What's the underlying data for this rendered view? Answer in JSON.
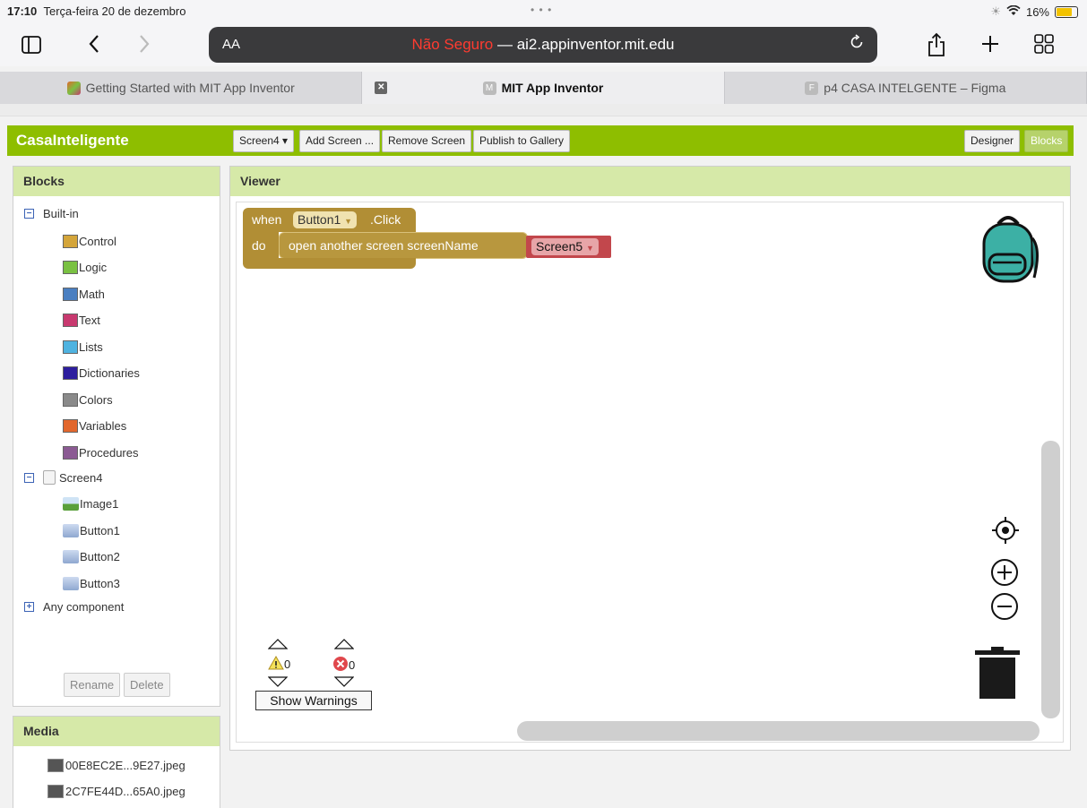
{
  "statusbar": {
    "time": "17:10",
    "date": "Terça-feira 20 de dezembro",
    "battery": "16%",
    "battery_level": 0.16
  },
  "browser": {
    "aa_label": "AA",
    "url_insecure": "Não Seguro",
    "url_sep": " — ",
    "url_host": "ai2.appinventor.mit.edu",
    "tabs": [
      {
        "label": "Getting Started with MIT App Inventor"
      },
      {
        "label": "MIT App Inventor",
        "favicon_letter": "M"
      },
      {
        "label": "p4 CASA INTELGENTE – Figma",
        "favicon_letter": "F"
      }
    ]
  },
  "app": {
    "title": "CasaInteligente",
    "screen_select": "Screen4 ▾",
    "add_screen": "Add Screen ...",
    "remove_screen": "Remove Screen",
    "publish": "Publish to Gallery",
    "designer": "Designer",
    "blocks": "Blocks"
  },
  "blocks_panel": {
    "title": "Blocks",
    "builtin_label": "Built-in",
    "builtin": [
      {
        "label": "Control",
        "color": "#d4a53a"
      },
      {
        "label": "Logic",
        "color": "#7ac142"
      },
      {
        "label": "Math",
        "color": "#4a7fc1"
      },
      {
        "label": "Text",
        "color": "#c8396f"
      },
      {
        "label": "Lists",
        "color": "#4fb3e0"
      },
      {
        "label": "Dictionaries",
        "color": "#2d1e9e"
      },
      {
        "label": "Colors",
        "color": "#8a8a8a"
      },
      {
        "label": "Variables",
        "color": "#e2672d"
      },
      {
        "label": "Procedures",
        "color": "#8b5a93"
      }
    ],
    "screen_label": "Screen4",
    "components": [
      {
        "label": "Image1"
      },
      {
        "label": "Button1"
      },
      {
        "label": "Button2"
      },
      {
        "label": "Button3"
      }
    ],
    "any_component": "Any component",
    "rename": "Rename",
    "delete": "Delete"
  },
  "media": {
    "title": "Media",
    "files": [
      "00E8EC2E...9E27.jpeg",
      "2C7FE44D...65A0.jpeg"
    ]
  },
  "viewer": {
    "title": "Viewer",
    "event_when": "when",
    "event_component": "Button1",
    "event_name": ".Click",
    "do_label": "do",
    "stmt_label": "open another screen  screenName",
    "screen_value": "Screen5",
    "warnings_count": "0",
    "errors_count": "0",
    "show_warnings": "Show Warnings"
  }
}
